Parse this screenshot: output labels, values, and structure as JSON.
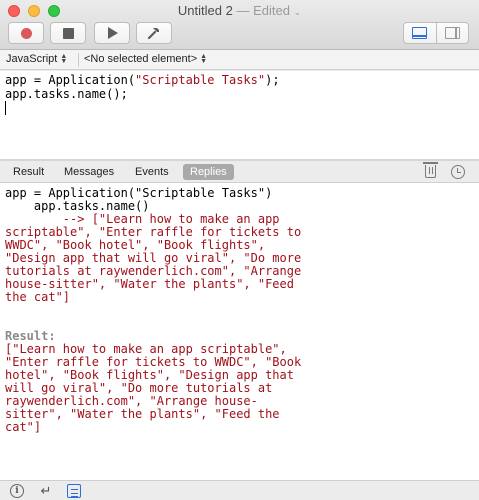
{
  "window": {
    "title": "Untitled 2",
    "separator": "—",
    "status": "Edited",
    "status_chevron": "⌄"
  },
  "toolbar": {
    "buttons": [
      "record-icon",
      "stop-icon",
      "run-icon",
      "compile-icon"
    ],
    "view_segments": [
      "split-view-icon",
      "sidebar-view-icon"
    ],
    "accent": "#2d6ddc"
  },
  "navbar": {
    "language": "JavaScript",
    "element": "<No selected element>"
  },
  "editor": {
    "line1_prefix": "app = Application(",
    "line1_string": "\"Scriptable Tasks\"",
    "line1_suffix": ");",
    "line2": "app.tasks.name();"
  },
  "tabs": {
    "result": "Result",
    "messages": "Messages",
    "events": "Events",
    "replies": "Replies",
    "active": "Replies"
  },
  "log": {
    "cmd1": "app = Application(\"Scriptable Tasks\")",
    "cmd2": "    app.tasks.name()",
    "reply_lines": [
      "        --> [\"Learn how to make an app",
      "scriptable\", \"Enter raffle for tickets to",
      "WWDC\", \"Book hotel\", \"Book flights\",",
      "\"Design app that will go viral\", \"Do more",
      "tutorials at raywenderlich.com\", \"Arrange",
      "house-sitter\", \"Water the plants\", \"Feed",
      "the cat\"]"
    ],
    "result_label": "Result:",
    "result_lines": [
      "[\"Learn how to make an app scriptable\",",
      "\"Enter raffle for tickets to WWDC\", \"Book",
      "hotel\", \"Book flights\", \"Design app that",
      "will go viral\", \"Do more tutorials at",
      "raywenderlich.com\", \"Arrange house-",
      "sitter\", \"Water the plants\", \"Feed the",
      "cat\"]"
    ],
    "string_color": "#a0121b"
  },
  "bottombar": {
    "return_glyph": "↵",
    "info_glyph": "i"
  }
}
